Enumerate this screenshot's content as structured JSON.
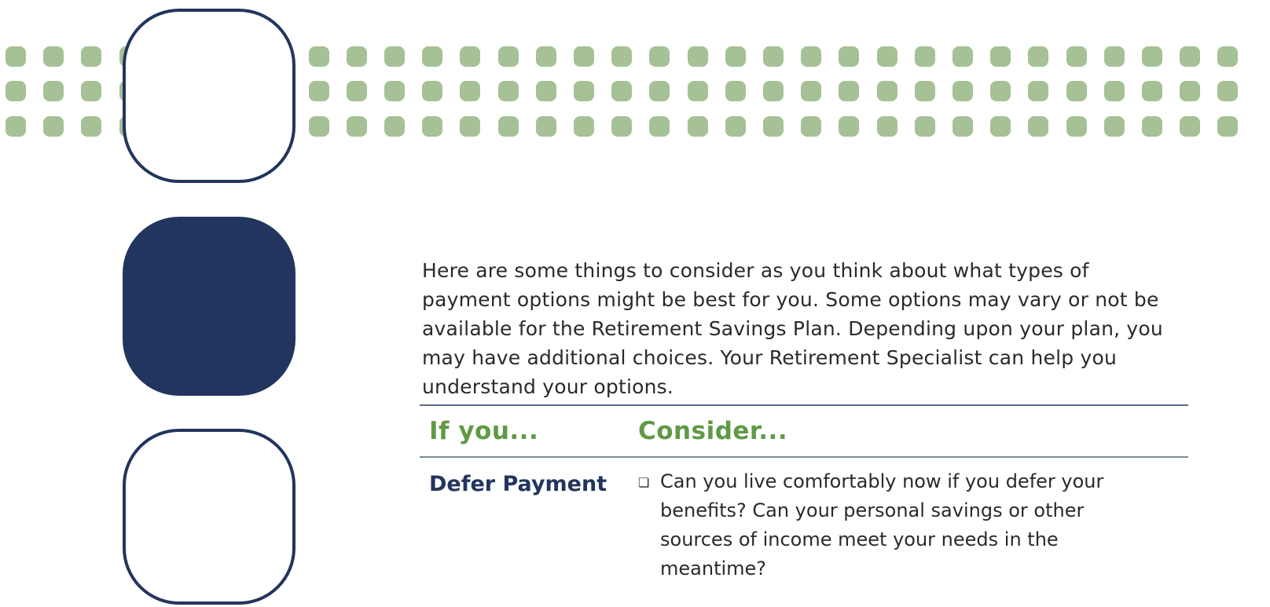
{
  "colors": {
    "accent_green": "#a6c196",
    "navy": "#22355e",
    "heading_green": "#5f9a45"
  },
  "intro": {
    "text": "Here are some things to consider as you think about what types of payment options might be best for you. Some options may vary or not be available for the Retirement Savings Plan. Depending upon your plan, you may have additional choices. Your Retirement Specialist can help you understand your options."
  },
  "table": {
    "header_if": "If you...",
    "header_consider": "Consider...",
    "rows": [
      {
        "label": "Defer Payment",
        "checkbox_icon": "checkbox-icon",
        "consideration": "Can you live comfortably now if you defer your benefits? Can your personal savings or other sources of income meet your needs in the meantime?"
      }
    ]
  }
}
